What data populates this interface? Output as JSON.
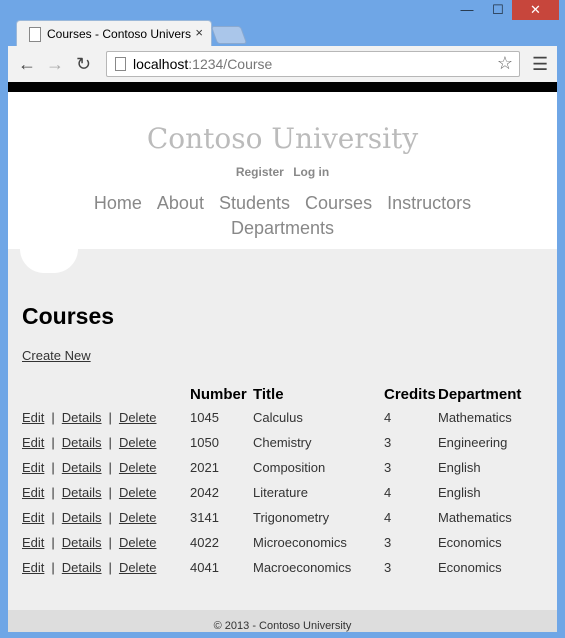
{
  "browser": {
    "tab_title": "Courses - Contoso Univers",
    "tab_close": "×",
    "window_min": "—",
    "window_max": "☐",
    "window_close": "✕",
    "url_host": "localhost",
    "url_path": ":1234/Course"
  },
  "site": {
    "title": "Contoso University",
    "register": "Register",
    "login": "Log in",
    "nav": [
      "Home",
      "About",
      "Students",
      "Courses",
      "Instructors",
      "Departments"
    ]
  },
  "page": {
    "heading": "Courses",
    "create_new": "Create New",
    "columns": [
      "Number",
      "Title",
      "Credits",
      "Department"
    ],
    "action_labels": {
      "edit": "Edit",
      "details": "Details",
      "delete": "Delete",
      "sep": "|"
    },
    "rows": [
      {
        "number": "1045",
        "title": "Calculus",
        "credits": "4",
        "department": "Mathematics"
      },
      {
        "number": "1050",
        "title": "Chemistry",
        "credits": "3",
        "department": "Engineering"
      },
      {
        "number": "2021",
        "title": "Composition",
        "credits": "3",
        "department": "English"
      },
      {
        "number": "2042",
        "title": "Literature",
        "credits": "4",
        "department": "English"
      },
      {
        "number": "3141",
        "title": "Trigonometry",
        "credits": "4",
        "department": "Mathematics"
      },
      {
        "number": "4022",
        "title": "Microeconomics",
        "credits": "3",
        "department": "Economics"
      },
      {
        "number": "4041",
        "title": "Macroeconomics",
        "credits": "3",
        "department": "Economics"
      }
    ],
    "footer": "© 2013 - Contoso University"
  }
}
